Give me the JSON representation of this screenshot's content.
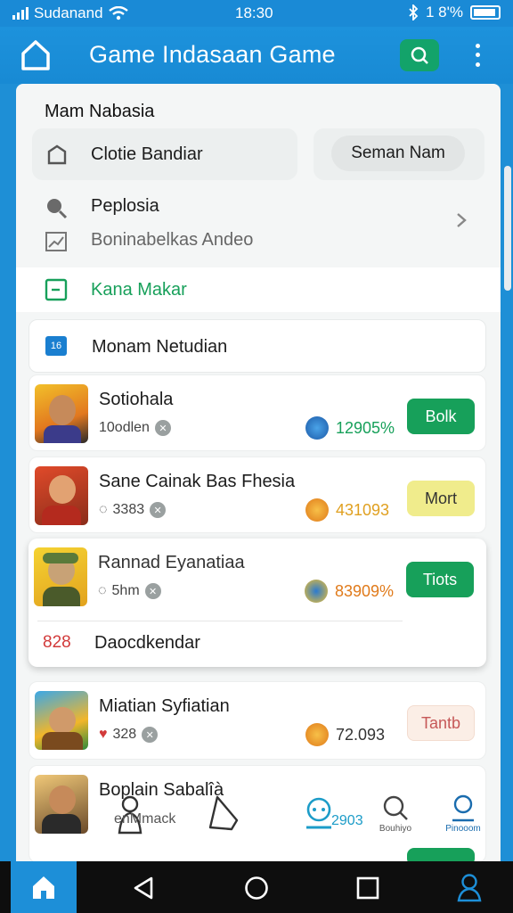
{
  "status_bar": {
    "carrier": "Sudanand",
    "time": "18:30",
    "battery_text": "1 8'%"
  },
  "app_bar": {
    "title": "Game Indasaan Game"
  },
  "menu": {
    "section_title": "Mam Nabasia",
    "pill_left_label": "Clotie Bandiar",
    "pill_right_label": "Seman Nam",
    "item_1": "Peplosia",
    "item_2": "Boninabelkas Andeo",
    "item_3": "Kana Makar",
    "item_4": "Monam Netudian"
  },
  "games": [
    {
      "name": "Sotiohala",
      "meta": "10odlen",
      "stat": "12905%",
      "action": "Bolk"
    },
    {
      "name": "Sane Cainak Bas Fhesia",
      "meta": "3383",
      "stat": "431093",
      "action": "Mort"
    },
    {
      "name": "Rannad Eyanatiaa",
      "meta": "5hm",
      "stat": "83909%",
      "action": "Tiots"
    },
    {
      "name": "Miatian Syfiatian",
      "meta": "328",
      "stat": "72.093",
      "action": "Tantb"
    },
    {
      "name": "Boplain Sabalîà",
      "meta": "",
      "stat": "",
      "action": ""
    }
  ],
  "footer_row": {
    "number": "828",
    "label": "Daocdkendar"
  },
  "bottom_nav": {
    "tab_3_text": "2903",
    "tab_4_label": "Bouhiyo",
    "tab_5_label": "Pinooom",
    "tab_2_text": "enMmack"
  },
  "colors": {
    "primary": "#1d8fd8",
    "green": "#17a05a",
    "yellow": "#f0ec8c"
  }
}
